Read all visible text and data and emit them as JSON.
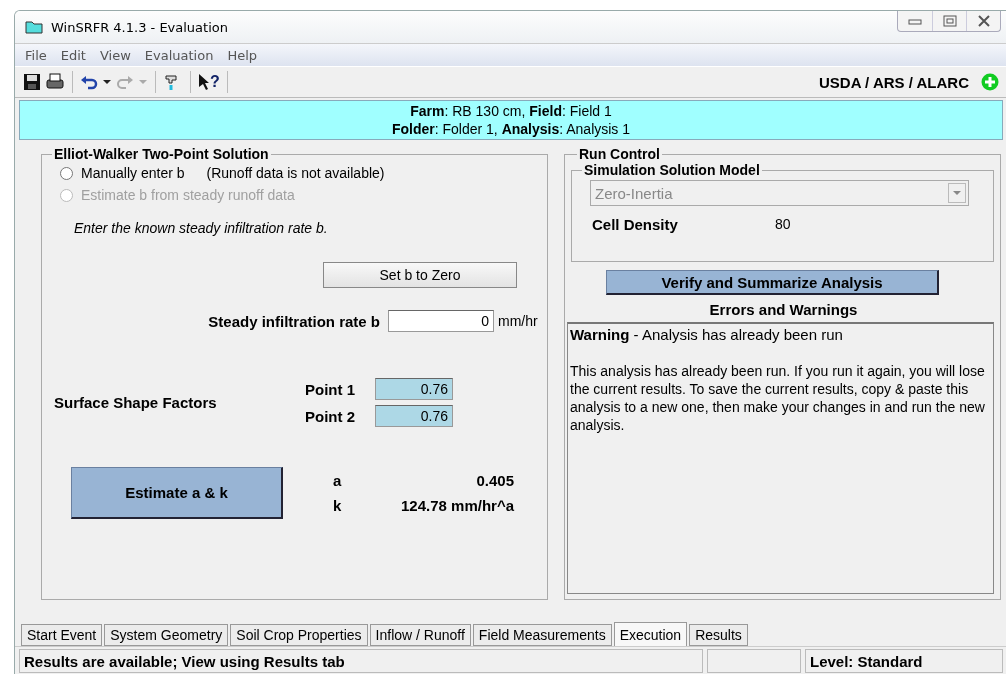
{
  "window": {
    "title": "WinSRFR 4.1.3 - Evaluation"
  },
  "menu": [
    "File",
    "Edit",
    "View",
    "Evaluation",
    "Help"
  ],
  "toolbar": {
    "help_glyph": "?",
    "org": "USDA / ARS / ALARC"
  },
  "header": {
    "line_1": "**Farm**: RB 130 cm, **Field**: Field 1",
    "line_2": "**Folder**: Folder 1, **Analysis**: Analysis 1"
  },
  "solution": {
    "title": "Elliot-Walker Two-Point Solution",
    "options": [
      {
        "label": "Manually enter b",
        "selected": false,
        "disabled": false
      },
      {
        "label": "Estimate b from steady runoff data",
        "selected": false,
        "disabled": true
      }
    ],
    "runoff_note": "(Runoff data is not available)",
    "instruction": "Enter the known steady infiltration rate b.",
    "zero_button": "Set b to Zero",
    "rate": {
      "label": "Steady infiltration rate b",
      "value": "0",
      "unit": "mm/hr"
    },
    "shape": {
      "label": "Surface Shape Factors",
      "points": [
        {
          "label": "Point 1",
          "value": "0.76"
        },
        {
          "label": "Point 2",
          "value": "0.76"
        }
      ]
    },
    "estimate_button": "Estimate a & k",
    "results": [
      {
        "label": "a",
        "value": "0.405"
      },
      {
        "label": "k",
        "value": "124.78 mm/hr^a"
      }
    ]
  },
  "run_control": {
    "title": "Run Control",
    "model_title": "Simulation Solution Model",
    "model": {
      "value": "Zero-Inertia",
      "disabled": true
    },
    "cell_density": {
      "label": "Cell Density",
      "value": "80"
    },
    "verify_button": "Verify and Summarize Analysis",
    "messages_title": "Errors and Warnings",
    "message_head": "**Warning** - Analysis has already been run",
    "message_body": "This analysis has already been run.  If you run it again, you will lose the current results.  To save the current results, copy & paste this analysis to a new one, then make your changes in and run the new analysis."
  },
  "tabs": [
    {
      "label": "Start Event",
      "selected": false
    },
    {
      "label": "System Geometry",
      "selected": false
    },
    {
      "label": "Soil Crop Properties",
      "selected": false
    },
    {
      "label": "Inflow / Runoff",
      "selected": false
    },
    {
      "label": "Field Measurements",
      "selected": false
    },
    {
      "label": "Execution",
      "selected": true
    },
    {
      "label": "Results",
      "selected": false
    }
  ],
  "status_bar": {
    "message": "Results are available; View using Results tab",
    "level": "Level: Standard"
  }
}
